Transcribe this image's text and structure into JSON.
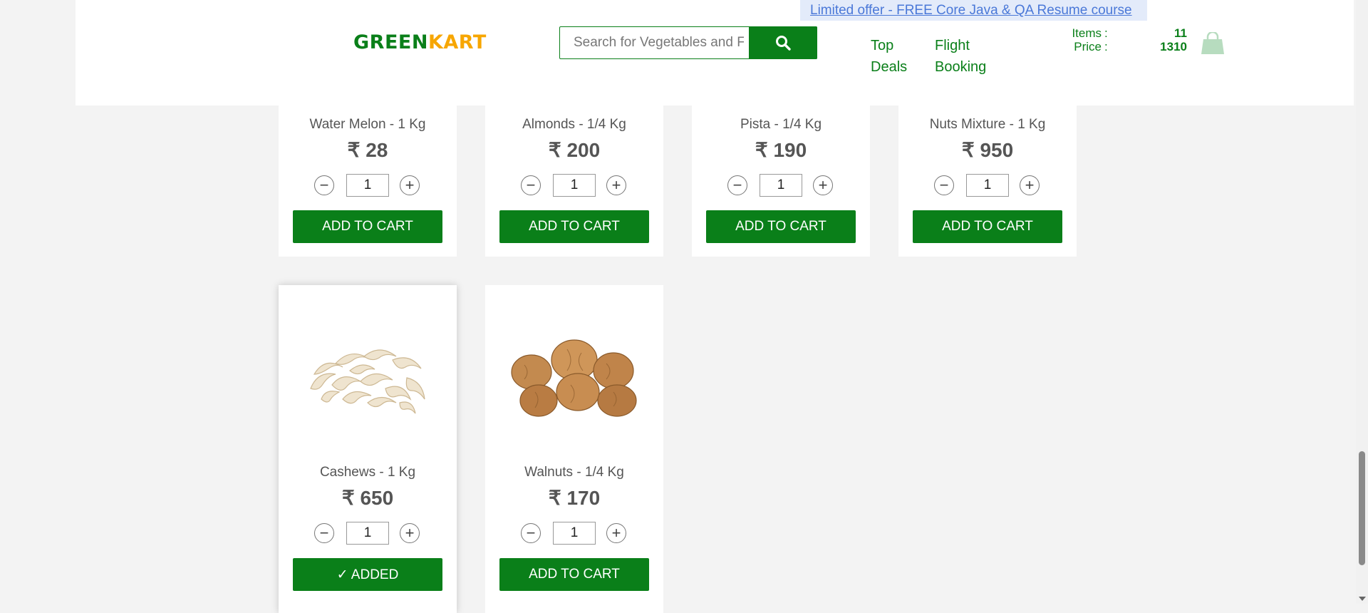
{
  "header": {
    "logo_part1": "GREEN",
    "logo_part2": "KART",
    "search_placeholder": "Search for Vegetables and Fruits",
    "promo_text": "Limited offer - FREE Core Java & QA Resume course",
    "nav": [
      {
        "line1": "Top",
        "line2": "Deals"
      },
      {
        "line1": "Flight",
        "line2": "Booking"
      }
    ],
    "cart": {
      "items_label": "Items",
      "items_value": "11",
      "price_label": "Price",
      "price_value": "1310",
      "colon": ":"
    }
  },
  "currency": "₹",
  "products": [
    {
      "name": "Water Melon - 1 Kg",
      "price": "₹ 28",
      "qty": "1",
      "button": "ADD TO CART"
    },
    {
      "name": "Almonds - 1/4 Kg",
      "price": "₹ 200",
      "qty": "1",
      "button": "ADD TO CART"
    },
    {
      "name": "Pista - 1/4 Kg",
      "price": "₹ 190",
      "qty": "1",
      "button": "ADD TO CART"
    },
    {
      "name": "Nuts Mixture - 1 Kg",
      "price": "₹ 950",
      "qty": "1",
      "button": "ADD TO CART"
    },
    {
      "name": "Cashews - 1 Kg",
      "price": "₹ 650",
      "qty": "1",
      "button": "✓ ADDED"
    },
    {
      "name": "Walnuts - 1/4 Kg",
      "price": "₹ 170",
      "qty": "1",
      "button": "ADD TO CART"
    }
  ],
  "stepper": {
    "minus": "−",
    "plus": "+"
  },
  "colors": {
    "brand_green": "#0a7f19",
    "brand_orange": "#f7a600",
    "promo_bg": "#e3ebfa"
  }
}
